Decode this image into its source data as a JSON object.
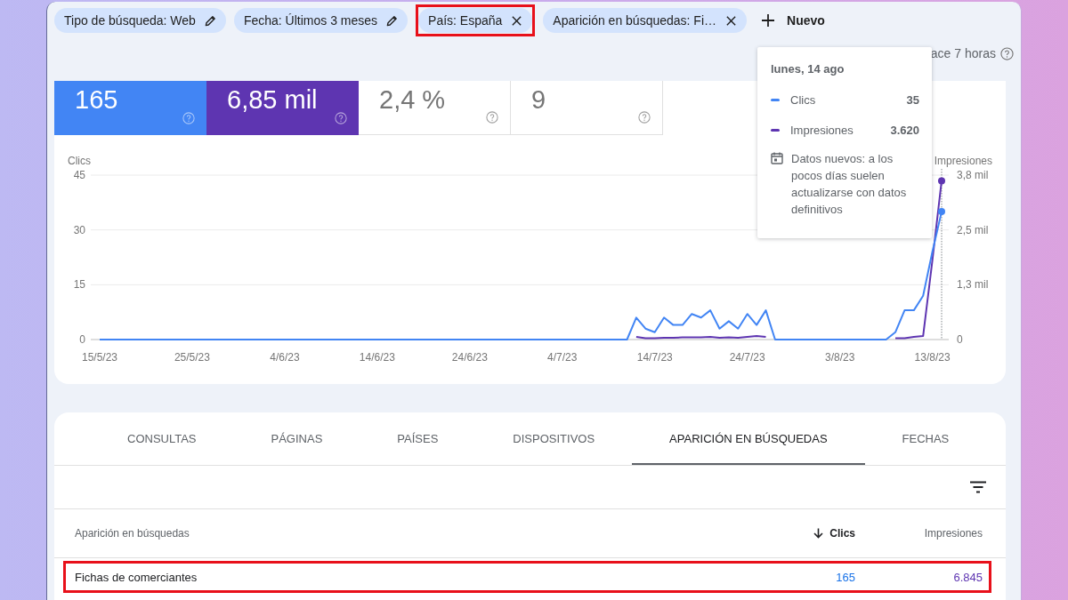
{
  "filters": {
    "chips": [
      {
        "label": "Tipo de búsqueda: Web",
        "kind": "edit",
        "highlighted": false
      },
      {
        "label": "Fecha: Últimos 3 meses",
        "kind": "edit",
        "highlighted": false
      },
      {
        "label": "País: España",
        "kind": "remove",
        "highlighted": true
      },
      {
        "label": "Aparición en búsquedas: Fi…",
        "kind": "remove",
        "highlighted": false
      }
    ],
    "new_button": {
      "label": "Nuevo"
    }
  },
  "status": {
    "last_update": "ace 7 horas"
  },
  "metrics": [
    {
      "value": "165",
      "selected": true,
      "color": "#4285f4"
    },
    {
      "value": "6,85 mil",
      "selected": true,
      "color": "#5e35b1"
    },
    {
      "value": "2,4 %",
      "selected": false
    },
    {
      "value": "9",
      "selected": false
    }
  ],
  "chart": {
    "chart_data": {
      "type": "line",
      "ylabel": "Clics",
      "y2label": "Impresiones",
      "categories": [
        "15/5/23",
        null,
        null,
        null,
        null,
        null,
        null,
        null,
        null,
        null,
        "25/5/23",
        null,
        null,
        null,
        null,
        null,
        null,
        null,
        null,
        null,
        "4/6/23",
        null,
        null,
        null,
        null,
        null,
        null,
        null,
        null,
        null,
        "14/6/23",
        null,
        null,
        null,
        null,
        null,
        null,
        null,
        null,
        null,
        "24/6/23",
        null,
        null,
        null,
        null,
        null,
        null,
        null,
        null,
        null,
        "4/7/23",
        null,
        null,
        null,
        null,
        null,
        null,
        null,
        null,
        null,
        "14/7/23",
        null,
        null,
        null,
        null,
        null,
        null,
        null,
        null,
        null,
        "24/7/23",
        null,
        null,
        null,
        null,
        null,
        null,
        null,
        null,
        null,
        "3/8/23",
        null,
        null,
        null,
        null,
        null,
        null,
        null,
        null,
        null,
        "13/8/23",
        null
      ],
      "ylim": [
        0,
        45
      ],
      "yticks": [
        0,
        15,
        30,
        45
      ],
      "y2lim": [
        0,
        3.75
      ],
      "y2ticks": [
        {
          "value": 0,
          "label": "0"
        },
        {
          "value": 1.25,
          "label": "1,3 mil"
        },
        {
          "value": 2.5,
          "label": "2,5 mil"
        },
        {
          "value": 3.75,
          "label": "3,8 mil"
        }
      ],
      "series": [
        {
          "color": "#5e35b1",
          "axis": "y2",
          "values": [
            null,
            null,
            null,
            null,
            null,
            null,
            null,
            null,
            null,
            null,
            null,
            null,
            null,
            null,
            null,
            null,
            null,
            null,
            null,
            null,
            null,
            null,
            null,
            null,
            null,
            null,
            null,
            null,
            null,
            null,
            null,
            null,
            null,
            null,
            null,
            null,
            null,
            null,
            null,
            null,
            null,
            null,
            null,
            null,
            null,
            null,
            null,
            null,
            null,
            null,
            null,
            null,
            null,
            null,
            null,
            null,
            null,
            null,
            0.06,
            0.03,
            0.03,
            0.04,
            0.04,
            0.05,
            0.05,
            0.05,
            0.06,
            0.04,
            0.05,
            0.04,
            0.06,
            0.08,
            0.06,
            null,
            null,
            null,
            null,
            null,
            null,
            null,
            null,
            null,
            null,
            null,
            null,
            null,
            0.03,
            0.03,
            0.06,
            0.08,
            1.8,
            3.62
          ]
        },
        {
          "color": "#4285f4",
          "axis": "y",
          "values": [
            0,
            0,
            0,
            0,
            0,
            0,
            0,
            0,
            0,
            0,
            0,
            0,
            0,
            0,
            0,
            0,
            0,
            0,
            0,
            0,
            0,
            0,
            0,
            0,
            0,
            0,
            0,
            0,
            0,
            0,
            0,
            0,
            0,
            0,
            0,
            0,
            0,
            0,
            0,
            0,
            0,
            0,
            0,
            0,
            0,
            0,
            0,
            0,
            0,
            0,
            0,
            0,
            0,
            0,
            0,
            0,
            0,
            0,
            6,
            3,
            2,
            6,
            4,
            4,
            7,
            6,
            8,
            3,
            5,
            3,
            7,
            4,
            8,
            0,
            0,
            0,
            0,
            0,
            0,
            0,
            0,
            0,
            0,
            0,
            0,
            0,
            2,
            8,
            8,
            12,
            24,
            35
          ]
        }
      ]
    }
  },
  "tooltip": {
    "date": "lunes, 14 ago",
    "rows": [
      {
        "label": "Clics",
        "value": "35",
        "color": "#4285f4"
      },
      {
        "label": "Impresiones",
        "value": "3.620",
        "color": "#5e35b1"
      }
    ],
    "note": "Datos nuevos: a los pocos días suelen actualizarse con datos definitivos"
  },
  "tabs": [
    {
      "label": "CONSULTAS",
      "selected": false
    },
    {
      "label": "PÁGINAS",
      "selected": false
    },
    {
      "label": "PAÍSES",
      "selected": false
    },
    {
      "label": "DISPOSITIVOS",
      "selected": false
    },
    {
      "label": "APARICIÓN EN BÚSQUEDAS",
      "selected": true
    },
    {
      "label": "FECHAS",
      "selected": false
    }
  ],
  "table": {
    "columns": [
      {
        "label": "Aparición en búsquedas",
        "sorted": false
      },
      {
        "label": "Clics",
        "sorted": true
      },
      {
        "label": "Impresiones",
        "sorted": false
      }
    ],
    "rows": [
      {
        "cells": [
          "Fichas de comerciantes",
          "165",
          "6.845"
        ],
        "highlighted": true
      }
    ]
  }
}
